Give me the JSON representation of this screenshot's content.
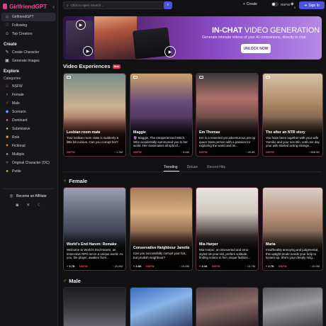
{
  "brand": {
    "name": "GirlfriendGPT",
    "accent": "#e7478f",
    "primary": "#4b55d8"
  },
  "sidebar": {
    "top_items": [
      {
        "label": "GirlfriendGPT",
        "icon": "home-icon"
      },
      {
        "label": "Following",
        "icon": "following-icon"
      },
      {
        "label": "Top Creators",
        "icon": "users-icon"
      }
    ],
    "create_title": "Create",
    "create_items": [
      {
        "label": "Create Character",
        "icon": "create-character-icon"
      },
      {
        "label": "Generate Images",
        "icon": "generate-images-icon"
      }
    ],
    "explore_title": "Explore",
    "categories_title": "Categories",
    "categories": [
      {
        "label": "NSFW",
        "icon": "flame-icon"
      },
      {
        "label": "Female",
        "icon": "female-icon"
      },
      {
        "label": "Male",
        "icon": "male-icon"
      },
      {
        "label": "Scenario",
        "icon": "scenario-icon"
      },
      {
        "label": "Dominant",
        "icon": "dominant-icon"
      },
      {
        "label": "Submissive",
        "icon": "submissive-icon"
      },
      {
        "label": "Role",
        "icon": "role-icon"
      },
      {
        "label": "Fictional",
        "icon": "fictional-icon"
      },
      {
        "label": "Multiple",
        "icon": "multiple-icon"
      },
      {
        "label": "Original Character (OC)",
        "icon": "original-character-icon"
      },
      {
        "label": "Petite",
        "icon": "petite-icon"
      }
    ],
    "affiliate_label": "Become an Affiliate"
  },
  "topbar": {
    "search_placeholder": "Click to open Search...",
    "create_label": "Create",
    "nsfw_label": "NSFW",
    "coin_count": "0",
    "signin_label": "Sign In"
  },
  "banner": {
    "title_bold": "IN-CHAT",
    "title_light": " VIDEO GENERATION",
    "subtitle": "Generate intimate videos of your AI companions, directly in chat.",
    "cta": "UNLOCK NOW"
  },
  "video_section": {
    "title": "Video Experiences",
    "badge": "New",
    "cards": [
      {
        "name": "Lesbian room mate",
        "desc": "Your lesbian room mate is suddenly a little bit curious. Can you corrupt her?",
        "tag": "NSFW",
        "stat": "1.3M"
      },
      {
        "name": "Maggie",
        "desc": "🔮 Maggie, The Inexperienced Witch. Who accidentally summoned you to her world. Her classmates all split of...",
        "tag": "NSFW",
        "stat": "5.6M"
      },
      {
        "name": "Em Thomas",
        "desc": "Em is a reserved yet adventurous pre-op queer trans person with a passion for exploring the world and its...",
        "tag": "NSFW",
        "stat": "49.8K"
      },
      {
        "name": "The after an NTR story",
        "desc": "You have been together with your wife Yumiko and your son Bin, until one day your wife started acting strange...",
        "tag": "NSFW",
        "stat": "898.5K"
      }
    ]
  },
  "tabs": {
    "items": [
      "Trending",
      "Deluxe",
      "Recent Hits"
    ],
    "active": "Trending"
  },
  "female_section": {
    "title": "Female",
    "cards": [
      {
        "name": "World's End Harem: Remake",
        "desc": "Welcome to World's End Harem, an immersive RPG set in a unique world. As you, the player, awaken from...",
        "likes": "3.7K",
        "tag": "NSFW",
        "stat": "20.8M"
      },
      {
        "name": "Conservative Neighbour Janette",
        "desc": "Can you successfully corrupt your hot, but prudish neighbour?",
        "likes": "3.6K",
        "tag": "NSFW",
        "stat": "15.8M"
      },
      {
        "name": "Mia Harper",
        "desc": "Mia Harper, an introverted and emo-styled 18-year-old, prefers solitude, finding solace in her unique fashion...",
        "likes": "3.1K",
        "tag": "NSFW",
        "stat": "13.7M"
      },
      {
        "name": "Maria",
        "desc": "Insufferably annoying and judgmental, this uptight prude needs your help to loosen up. She's your deeply relig...",
        "likes": "2.7K",
        "tag": "NSFW",
        "stat": "10.5M"
      }
    ]
  },
  "male_section": {
    "title": "Male"
  }
}
